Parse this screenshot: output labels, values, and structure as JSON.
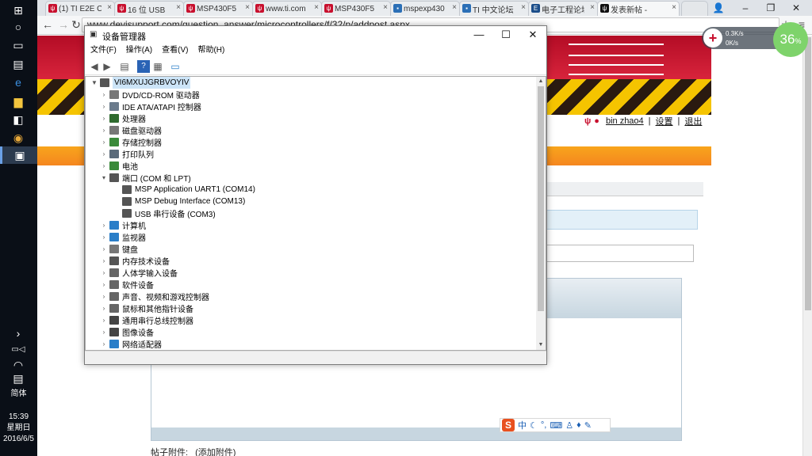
{
  "taskbar": {
    "clock": "15:39",
    "weekday": "星期日",
    "date": "2016/6/5",
    "ime_label": "简体"
  },
  "browser": {
    "tabs": [
      {
        "label": "(1) TI E2E C",
        "fav_color": "#c8102e",
        "active": false
      },
      {
        "label": "16 位 USB",
        "fav_color": "#c8102e",
        "active": false
      },
      {
        "label": "MSP430F5",
        "fav_color": "#c8102e",
        "active": false
      },
      {
        "label": "www.ti.com",
        "fav_color": "#c8102e",
        "active": false
      },
      {
        "label": "MSP430F5",
        "fav_color": "#c8102e",
        "active": false
      },
      {
        "label": "mspexp430",
        "fav_color": "#2b6fb6",
        "active": false
      },
      {
        "label": "TI 中文论坛",
        "fav_color": "#2b6fb6",
        "active": false
      },
      {
        "label": "电子工程论坛",
        "fav_color": "#1c4e8a",
        "active": false
      },
      {
        "label": "发表新帖 -",
        "fav_color": "#111111",
        "active": true
      }
    ],
    "url": "www.deyisupport.com/question_answer/microcontrollers/f/32/p/addpost.aspx"
  },
  "page": {
    "user_name": "bin zhao4",
    "settings_label": "设置",
    "logout_label": "退出",
    "attach_label": "帖子附件:",
    "attach_link": "(添加附件)"
  },
  "netwidget": {
    "up": "0.3K/s",
    "down": "0K/s",
    "percent": "36"
  },
  "device_manager": {
    "title": "设备管理器",
    "menu": [
      "文件(F)",
      "操作(A)",
      "查看(V)",
      "帮助(H)"
    ],
    "root": "VI6MXUJGRBVOYIV",
    "items": [
      {
        "label": "DVD/CD-ROM 驱动器",
        "level": 1,
        "expand": "collapsed",
        "color": "#777777"
      },
      {
        "label": "IDE ATA/ATAPI 控制器",
        "level": 1,
        "expand": "collapsed",
        "color": "#6b7b8c"
      },
      {
        "label": "处理器",
        "level": 1,
        "expand": "collapsed",
        "color": "#2f6b2f"
      },
      {
        "label": "磁盘驱动器",
        "level": 1,
        "expand": "collapsed",
        "color": "#777777"
      },
      {
        "label": "存储控制器",
        "level": 1,
        "expand": "collapsed",
        "color": "#3a8a3a"
      },
      {
        "label": "打印队列",
        "level": 1,
        "expand": "collapsed",
        "color": "#5a6a7a"
      },
      {
        "label": "电池",
        "level": 1,
        "expand": "collapsed",
        "color": "#3a8a3a"
      },
      {
        "label": "端口 (COM 和 LPT)",
        "level": 1,
        "expand": "expanded",
        "color": "#555555"
      },
      {
        "label": "MSP Application UART1 (COM14)",
        "level": 2,
        "expand": "none",
        "color": "#555555"
      },
      {
        "label": "MSP Debug Interface (COM13)",
        "level": 2,
        "expand": "none",
        "color": "#555555"
      },
      {
        "label": "USB 串行设备 (COM3)",
        "level": 2,
        "expand": "none",
        "color": "#555555"
      },
      {
        "label": "计算机",
        "level": 1,
        "expand": "collapsed",
        "color": "#2a7ec8"
      },
      {
        "label": "监视器",
        "level": 1,
        "expand": "collapsed",
        "color": "#2a7ec8"
      },
      {
        "label": "键盘",
        "level": 1,
        "expand": "collapsed",
        "color": "#777777"
      },
      {
        "label": "内存技术设备",
        "level": 1,
        "expand": "collapsed",
        "color": "#555555"
      },
      {
        "label": "人体学输入设备",
        "level": 1,
        "expand": "collapsed",
        "color": "#666666"
      },
      {
        "label": "软件设备",
        "level": 1,
        "expand": "collapsed",
        "color": "#666666"
      },
      {
        "label": "声音、视频和游戏控制器",
        "level": 1,
        "expand": "collapsed",
        "color": "#666666"
      },
      {
        "label": "鼠标和其他指针设备",
        "level": 1,
        "expand": "collapsed",
        "color": "#666666"
      },
      {
        "label": "通用串行总线控制器",
        "level": 1,
        "expand": "collapsed",
        "color": "#444444"
      },
      {
        "label": "图像设备",
        "level": 1,
        "expand": "collapsed",
        "color": "#444444"
      },
      {
        "label": "网络适配器",
        "level": 1,
        "expand": "collapsed",
        "color": "#2a7ec8"
      }
    ]
  },
  "ime_bar": {
    "logo": "S",
    "mode": "中"
  }
}
